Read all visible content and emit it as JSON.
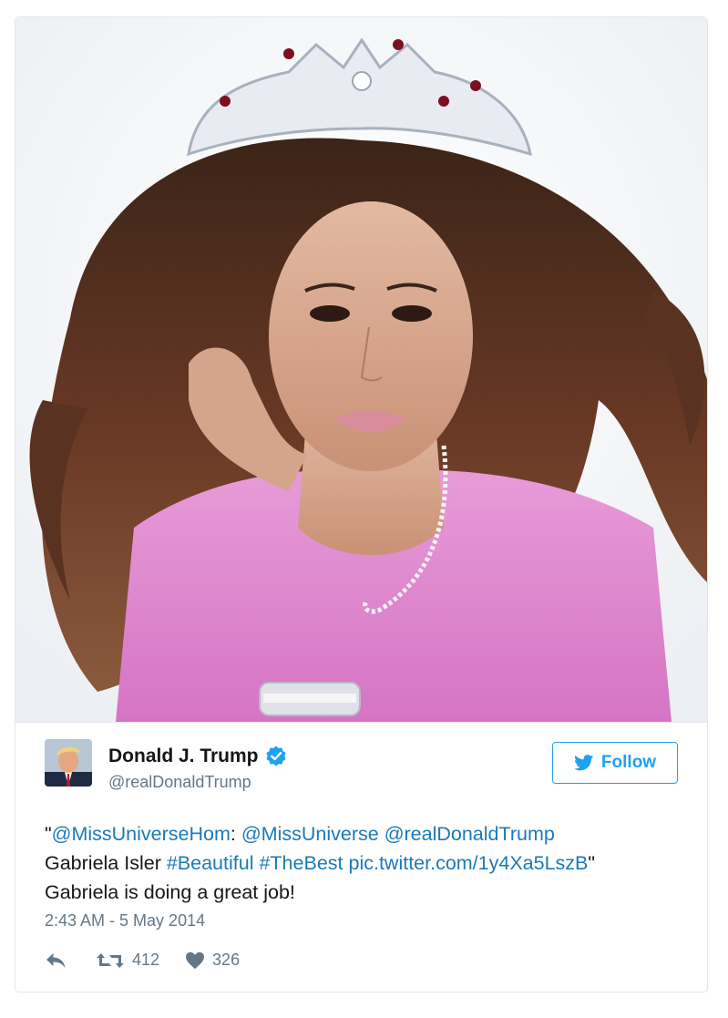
{
  "tweet": {
    "author": {
      "name": "Donald J. Trump",
      "handle": "@realDonaldTrump",
      "verified": true
    },
    "follow_label": "Follow",
    "text": {
      "quote_open": "\"",
      "mention_1": "@MissUniverseHom",
      "colon": ": ",
      "mention_2": "@MissUniverse",
      "space_1": " ",
      "mention_3": "@realDonaldTrump",
      "name_text": "Gabriela Isler ",
      "hashtag_1": "#Beautiful",
      "space_2": " ",
      "hashtag_2": "#TheBest",
      "space_3": " ",
      "link": "pic.twitter.com/1y4Xa5LszB",
      "quote_close": "\"",
      "line_3": "Gabriela is doing a great job!"
    },
    "timestamp": "2:43 AM - 5 May 2014",
    "retweet_count": "412",
    "like_count": "326"
  },
  "icons": {
    "reply": "reply-icon",
    "retweet": "retweet-icon",
    "like": "heart-icon",
    "verified": "verified-badge-icon",
    "follow": "twitter-bird-icon"
  },
  "colors": {
    "accent": "#1da1f2",
    "link": "#1b7ab8",
    "muted": "#657786",
    "border": "#e1e8ed"
  }
}
